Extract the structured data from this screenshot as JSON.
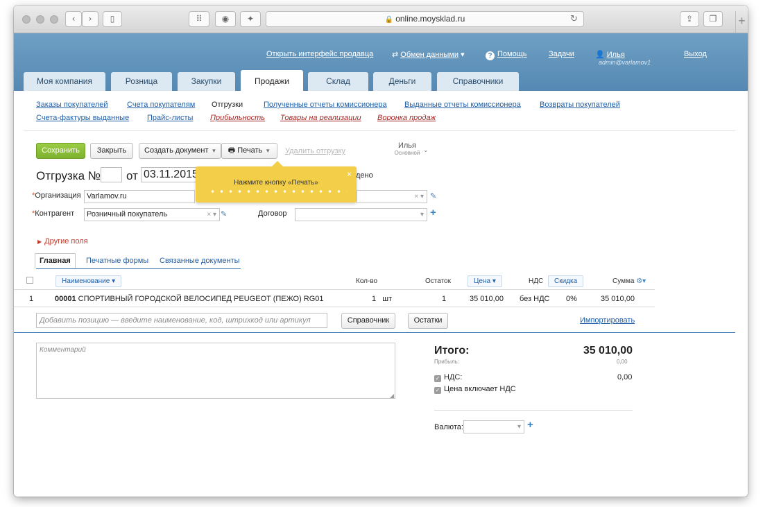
{
  "browser": {
    "url": "online.moysklad.ru"
  },
  "header": {
    "seller_link": "Открыть интерфейс продавца",
    "exchange": "Обмен данными",
    "help": "Помощь",
    "tasks": "Задачи",
    "user_name": "Илья",
    "user_login": "admin@varlamov1",
    "logout": "Выход"
  },
  "tabs": [
    "Моя компания",
    "Розница",
    "Закупки",
    "Продажи",
    "Склад",
    "Деньги",
    "Справочники"
  ],
  "subnav": {
    "row1": [
      "Заказы покупателей",
      "Счета покупателям",
      "Отгрузки",
      "Полученные отчеты комиссионера",
      "Выданные отчеты комиссионера",
      "Возвраты покупателей"
    ],
    "row2": [
      "Счета-фактуры выданные",
      "Прайс-листы",
      "Прибыльность",
      "Товары на реализации",
      "Воронка продаж"
    ]
  },
  "toolbar": {
    "save": "Сохранить",
    "close": "Закрыть",
    "create_doc": "Создать документ",
    "print": "Печать",
    "delete": "Удалить отгрузку",
    "owner_name": "Илья",
    "owner_group": "Основной"
  },
  "document": {
    "title": "Отгрузка №",
    "from": "от",
    "date": "03.11.2015",
    "status_tail": "дено"
  },
  "tooltip": {
    "text": "Нажмите кнопку «Печать»",
    "close": "×"
  },
  "fields": {
    "org_label": "Организация",
    "org_value": "Varlamov.ru",
    "contractor_label": "Контрагент",
    "contractor_value": "Розничный покупатель",
    "contract_label": "Договор",
    "other_fields": "Другие поля"
  },
  "doc_tabs": [
    "Главная",
    "Печатные формы",
    "Связанные документы"
  ],
  "table": {
    "headers": {
      "name": "Наименование",
      "qty": "Кол-во",
      "stock": "Остаток",
      "price": "Цена",
      "vat": "НДС",
      "discount": "Скидка",
      "sum": "Сумма"
    },
    "rows": [
      {
        "num": "1",
        "code": "00001",
        "name": "СПОРТИВНЫЙ ГОРОДСКОЙ ВЕЛОСИПЕД PEUGEOT (ПЕЖО) RG01",
        "qty": "1",
        "unit": "шт",
        "stock": "1",
        "price": "35 010,00",
        "vat": "без НДС",
        "discount": "0%",
        "sum": "35 010,00"
      }
    ],
    "add_placeholder": "Добавить позицию — введите наименование, код, штрихкод или артикул",
    "directory": "Справочник",
    "remains": "Остатки",
    "import": "Импортировать"
  },
  "comment_placeholder": "Комментарий",
  "totals": {
    "label": "Итого:",
    "value": "35 010,00",
    "profit_label": "Прибыль:",
    "profit_value": "0,00",
    "vat_label": "НДС:",
    "vat_value": "0,00",
    "price_incl_vat": "Цена включает НДС",
    "currency_label": "Валюта:"
  }
}
